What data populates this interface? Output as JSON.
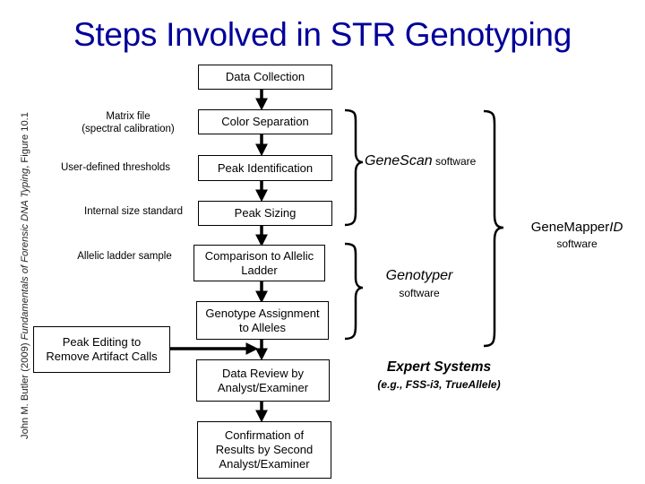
{
  "title": "Steps Involved in STR Genotyping",
  "credit": {
    "author": "John M. Butler (2009)",
    "book": "Fundamentals of Forensic DNA Typing",
    "figure": ", Figure 10.1"
  },
  "steps": [
    {
      "id": "data-collection",
      "label": "Data Collection"
    },
    {
      "id": "color-separation",
      "label": "Color Separation"
    },
    {
      "id": "peak-identification",
      "label": "Peak Identification"
    },
    {
      "id": "peak-sizing",
      "label": "Peak Sizing"
    },
    {
      "id": "comparison-allelic-ladder",
      "label": "Comparison to Allelic\nLadder"
    },
    {
      "id": "genotype-assignment",
      "label": "Genotype Assignment\nto Alleles"
    },
    {
      "id": "data-review",
      "label": "Data Review by\nAnalyst/Examiner"
    },
    {
      "id": "confirmation",
      "label": "Confirmation of\nResults by Second\nAnalyst/Examiner"
    }
  ],
  "inputs": [
    {
      "id": "matrix-file",
      "label": "Matrix file\n(spectral calibration)"
    },
    {
      "id": "user-thresholds",
      "label": "User-defined thresholds"
    },
    {
      "id": "internal-size-standard",
      "label": "Internal size standard"
    },
    {
      "id": "allelic-ladder-sample",
      "label": "Allelic ladder sample"
    }
  ],
  "peak_editing": {
    "label": "Peak Editing to\nRemove Artifact Calls"
  },
  "software": {
    "genescan": {
      "name": "GeneScan",
      "suffix": " software"
    },
    "genotyper": {
      "name": "Genotyper",
      "suffix": "software"
    },
    "genemapper": {
      "name": "GeneMapper",
      "name_italic": "ID",
      "suffix": "software"
    },
    "expert_systems": {
      "name": "Expert Systems",
      "examples": "(e.g., FSS-i3, TrueAllele)"
    }
  }
}
